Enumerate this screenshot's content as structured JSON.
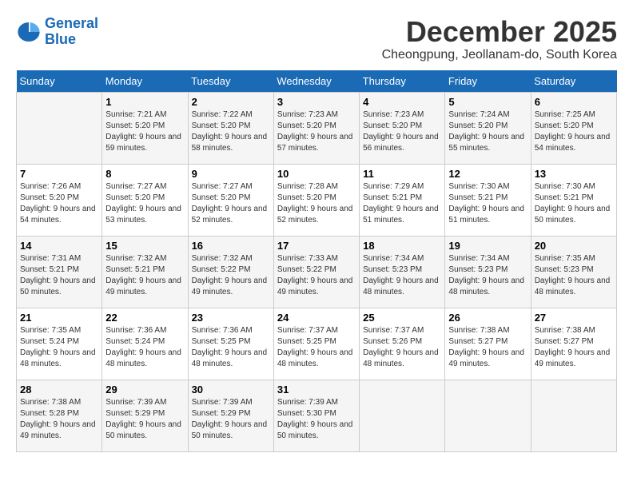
{
  "logo": {
    "line1": "General",
    "line2": "Blue"
  },
  "title": "December 2025",
  "location": "Cheongpung, Jeollanam-do, South Korea",
  "days_of_week": [
    "Sunday",
    "Monday",
    "Tuesday",
    "Wednesday",
    "Thursday",
    "Friday",
    "Saturday"
  ],
  "weeks": [
    [
      {
        "num": "",
        "sunrise": "",
        "sunset": "",
        "daylight": ""
      },
      {
        "num": "1",
        "sunrise": "Sunrise: 7:21 AM",
        "sunset": "Sunset: 5:20 PM",
        "daylight": "Daylight: 9 hours and 59 minutes."
      },
      {
        "num": "2",
        "sunrise": "Sunrise: 7:22 AM",
        "sunset": "Sunset: 5:20 PM",
        "daylight": "Daylight: 9 hours and 58 minutes."
      },
      {
        "num": "3",
        "sunrise": "Sunrise: 7:23 AM",
        "sunset": "Sunset: 5:20 PM",
        "daylight": "Daylight: 9 hours and 57 minutes."
      },
      {
        "num": "4",
        "sunrise": "Sunrise: 7:23 AM",
        "sunset": "Sunset: 5:20 PM",
        "daylight": "Daylight: 9 hours and 56 minutes."
      },
      {
        "num": "5",
        "sunrise": "Sunrise: 7:24 AM",
        "sunset": "Sunset: 5:20 PM",
        "daylight": "Daylight: 9 hours and 55 minutes."
      },
      {
        "num": "6",
        "sunrise": "Sunrise: 7:25 AM",
        "sunset": "Sunset: 5:20 PM",
        "daylight": "Daylight: 9 hours and 54 minutes."
      }
    ],
    [
      {
        "num": "7",
        "sunrise": "Sunrise: 7:26 AM",
        "sunset": "Sunset: 5:20 PM",
        "daylight": "Daylight: 9 hours and 54 minutes."
      },
      {
        "num": "8",
        "sunrise": "Sunrise: 7:27 AM",
        "sunset": "Sunset: 5:20 PM",
        "daylight": "Daylight: 9 hours and 53 minutes."
      },
      {
        "num": "9",
        "sunrise": "Sunrise: 7:27 AM",
        "sunset": "Sunset: 5:20 PM",
        "daylight": "Daylight: 9 hours and 52 minutes."
      },
      {
        "num": "10",
        "sunrise": "Sunrise: 7:28 AM",
        "sunset": "Sunset: 5:20 PM",
        "daylight": "Daylight: 9 hours and 52 minutes."
      },
      {
        "num": "11",
        "sunrise": "Sunrise: 7:29 AM",
        "sunset": "Sunset: 5:21 PM",
        "daylight": "Daylight: 9 hours and 51 minutes."
      },
      {
        "num": "12",
        "sunrise": "Sunrise: 7:30 AM",
        "sunset": "Sunset: 5:21 PM",
        "daylight": "Daylight: 9 hours and 51 minutes."
      },
      {
        "num": "13",
        "sunrise": "Sunrise: 7:30 AM",
        "sunset": "Sunset: 5:21 PM",
        "daylight": "Daylight: 9 hours and 50 minutes."
      }
    ],
    [
      {
        "num": "14",
        "sunrise": "Sunrise: 7:31 AM",
        "sunset": "Sunset: 5:21 PM",
        "daylight": "Daylight: 9 hours and 50 minutes."
      },
      {
        "num": "15",
        "sunrise": "Sunrise: 7:32 AM",
        "sunset": "Sunset: 5:21 PM",
        "daylight": "Daylight: 9 hours and 49 minutes."
      },
      {
        "num": "16",
        "sunrise": "Sunrise: 7:32 AM",
        "sunset": "Sunset: 5:22 PM",
        "daylight": "Daylight: 9 hours and 49 minutes."
      },
      {
        "num": "17",
        "sunrise": "Sunrise: 7:33 AM",
        "sunset": "Sunset: 5:22 PM",
        "daylight": "Daylight: 9 hours and 49 minutes."
      },
      {
        "num": "18",
        "sunrise": "Sunrise: 7:34 AM",
        "sunset": "Sunset: 5:23 PM",
        "daylight": "Daylight: 9 hours and 48 minutes."
      },
      {
        "num": "19",
        "sunrise": "Sunrise: 7:34 AM",
        "sunset": "Sunset: 5:23 PM",
        "daylight": "Daylight: 9 hours and 48 minutes."
      },
      {
        "num": "20",
        "sunrise": "Sunrise: 7:35 AM",
        "sunset": "Sunset: 5:23 PM",
        "daylight": "Daylight: 9 hours and 48 minutes."
      }
    ],
    [
      {
        "num": "21",
        "sunrise": "Sunrise: 7:35 AM",
        "sunset": "Sunset: 5:24 PM",
        "daylight": "Daylight: 9 hours and 48 minutes."
      },
      {
        "num": "22",
        "sunrise": "Sunrise: 7:36 AM",
        "sunset": "Sunset: 5:24 PM",
        "daylight": "Daylight: 9 hours and 48 minutes."
      },
      {
        "num": "23",
        "sunrise": "Sunrise: 7:36 AM",
        "sunset": "Sunset: 5:25 PM",
        "daylight": "Daylight: 9 hours and 48 minutes."
      },
      {
        "num": "24",
        "sunrise": "Sunrise: 7:37 AM",
        "sunset": "Sunset: 5:25 PM",
        "daylight": "Daylight: 9 hours and 48 minutes."
      },
      {
        "num": "25",
        "sunrise": "Sunrise: 7:37 AM",
        "sunset": "Sunset: 5:26 PM",
        "daylight": "Daylight: 9 hours and 48 minutes."
      },
      {
        "num": "26",
        "sunrise": "Sunrise: 7:38 AM",
        "sunset": "Sunset: 5:27 PM",
        "daylight": "Daylight: 9 hours and 49 minutes."
      },
      {
        "num": "27",
        "sunrise": "Sunrise: 7:38 AM",
        "sunset": "Sunset: 5:27 PM",
        "daylight": "Daylight: 9 hours and 49 minutes."
      }
    ],
    [
      {
        "num": "28",
        "sunrise": "Sunrise: 7:38 AM",
        "sunset": "Sunset: 5:28 PM",
        "daylight": "Daylight: 9 hours and 49 minutes."
      },
      {
        "num": "29",
        "sunrise": "Sunrise: 7:39 AM",
        "sunset": "Sunset: 5:29 PM",
        "daylight": "Daylight: 9 hours and 50 minutes."
      },
      {
        "num": "30",
        "sunrise": "Sunrise: 7:39 AM",
        "sunset": "Sunset: 5:29 PM",
        "daylight": "Daylight: 9 hours and 50 minutes."
      },
      {
        "num": "31",
        "sunrise": "Sunrise: 7:39 AM",
        "sunset": "Sunset: 5:30 PM",
        "daylight": "Daylight: 9 hours and 50 minutes."
      },
      {
        "num": "",
        "sunrise": "",
        "sunset": "",
        "daylight": ""
      },
      {
        "num": "",
        "sunrise": "",
        "sunset": "",
        "daylight": ""
      },
      {
        "num": "",
        "sunrise": "",
        "sunset": "",
        "daylight": ""
      }
    ]
  ]
}
